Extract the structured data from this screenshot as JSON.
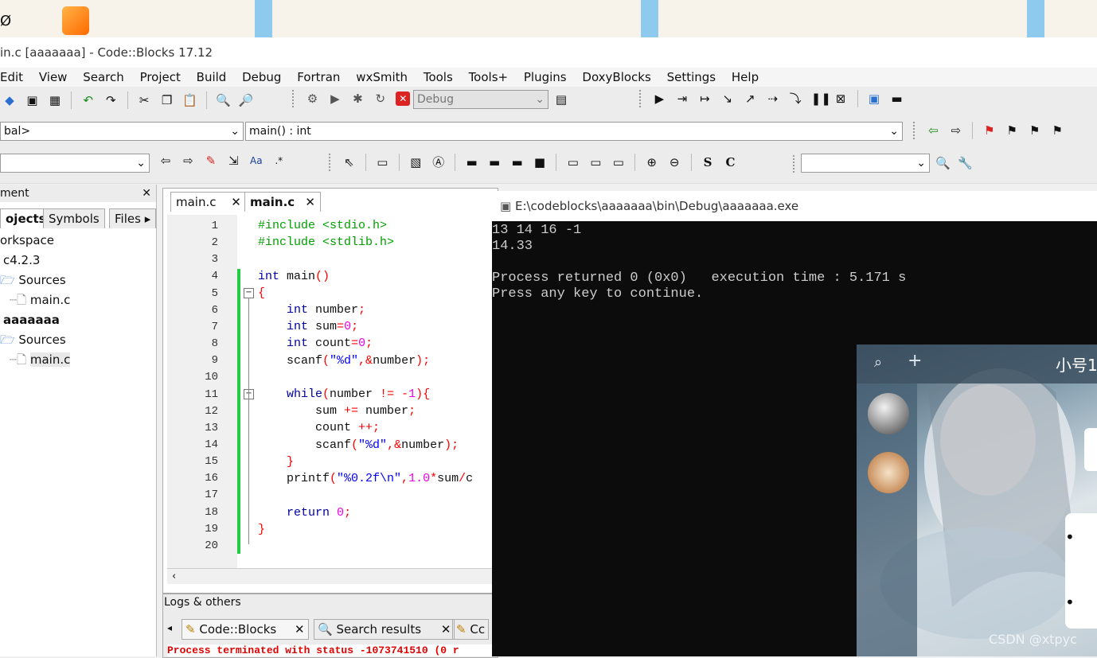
{
  "app_title": "in.c [aaaaaaa] - Code::Blocks 17.12",
  "menu": [
    "Edit",
    "View",
    "Search",
    "Project",
    "Build",
    "Debug",
    "Fortran",
    "wxSmith",
    "Tools",
    "Tools+",
    "Plugins",
    "DoxyBlocks",
    "Settings",
    "Help"
  ],
  "toolbar": {
    "build_target": "Debug",
    "scope_combo": "bal>",
    "function_combo": "main() : int"
  },
  "left_panel": {
    "header": "ment",
    "tabs": [
      "ojects",
      "Symbols",
      "Files"
    ],
    "tree": [
      "orkspace",
      "c4.2.3",
      "Sources",
      "main.c",
      "aaaaaaa",
      "Sources",
      "main.c"
    ]
  },
  "editor": {
    "tabs": [
      "main.c",
      "main.c"
    ],
    "line_numbers": [
      "1",
      "2",
      "3",
      "4",
      "5",
      "6",
      "7",
      "8",
      "9",
      "10",
      "11",
      "12",
      "13",
      "14",
      "15",
      "16",
      "17",
      "18",
      "19",
      "20"
    ]
  },
  "logs": {
    "header": "Logs & others",
    "tabs": [
      "Code::Blocks",
      "Search results",
      "Cc"
    ],
    "status": "Process terminated with status -1073741510 (0 r"
  },
  "console": {
    "title": "E:\\codeblocks\\aaaaaaa\\bin\\Debug\\aaaaaaa.exe",
    "lines": [
      "13 14 16 -1",
      "14.33",
      "",
      "Process returned 0 (0x0)   execution time : 5.171 s",
      "Press any key to continue."
    ]
  },
  "chat": {
    "title": "小号1",
    "watermark": "CSDN @xtpyc"
  }
}
